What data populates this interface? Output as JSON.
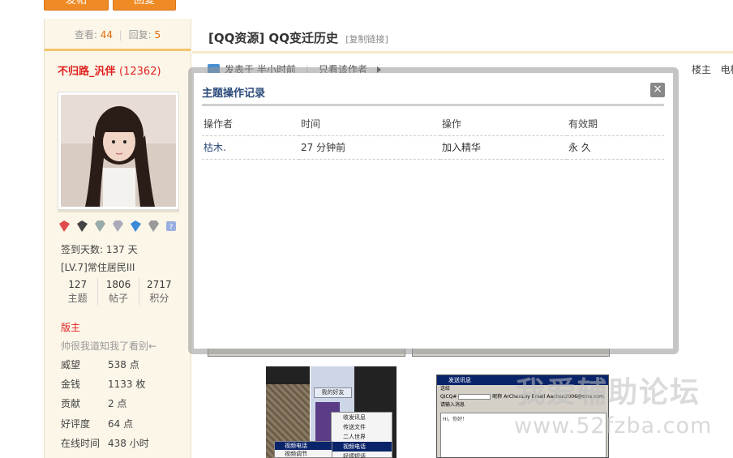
{
  "top_buttons": {
    "reply": "发帖",
    "fav": "回复"
  },
  "sidebar": {
    "views_label": "查看:",
    "views": "44",
    "replies_label": "回复:",
    "replies": "5",
    "username": "不归路_汎伴",
    "user_count": "(12362)",
    "checkin": "签到天数: 137 天",
    "level": "[LV.7]常住居民III",
    "stats": [
      {
        "value": "127",
        "label": "主题"
      },
      {
        "value": "1806",
        "label": "帖子"
      },
      {
        "value": "2717",
        "label": "积分"
      }
    ],
    "role": "版主",
    "signature": "帅很我道知我了看别←",
    "props": [
      {
        "k": "威望",
        "v": "538 点"
      },
      {
        "k": "金钱",
        "v": "1133 枚"
      },
      {
        "k": "贡献",
        "v": "2 点"
      },
      {
        "k": "好评度",
        "v": "64 点"
      },
      {
        "k": "在线时间",
        "v": "438 小时"
      }
    ]
  },
  "main": {
    "title": "[QQ资源] QQ变迁历史",
    "copy_link": "[复制链接]",
    "posted": "发表于 半小时前",
    "only_author": "只看该作者",
    "floor": "楼主",
    "floor2": "电梯"
  },
  "modal": {
    "title": "主题操作记录",
    "close": "×",
    "headers": [
      "操作者",
      "时间",
      "操作",
      "有效期"
    ],
    "rows": [
      {
        "operator": "枯木.",
        "time": "27 分钟前",
        "action": "加入精华",
        "validity": "永 久"
      }
    ]
  },
  "qq_shot1": {
    "friend_header": "我的好友",
    "menu": [
      "收发讯息",
      "传送文件",
      "二人世界",
      "视频电话",
      "好烦短话"
    ],
    "submenu": [
      "视频电话",
      "视频调节"
    ]
  },
  "qq_shot2": {
    "title": "发送讯息",
    "tab": "送给",
    "qq_label": "QICQ#",
    "nick_label": "昵称",
    "nick": "ArChenLoy",
    "email_label": "Email",
    "email": "Aachen2006@sina.com",
    "msg_label": "请输入消息",
    "msg": "Hi，你好！"
  },
  "watermark": {
    "line1": "我爱辅助论坛",
    "line2": "www.52fzba.com"
  },
  "colors": {
    "accent": "#f08a24",
    "link": "#2b4a7a",
    "red": "#e02020"
  }
}
